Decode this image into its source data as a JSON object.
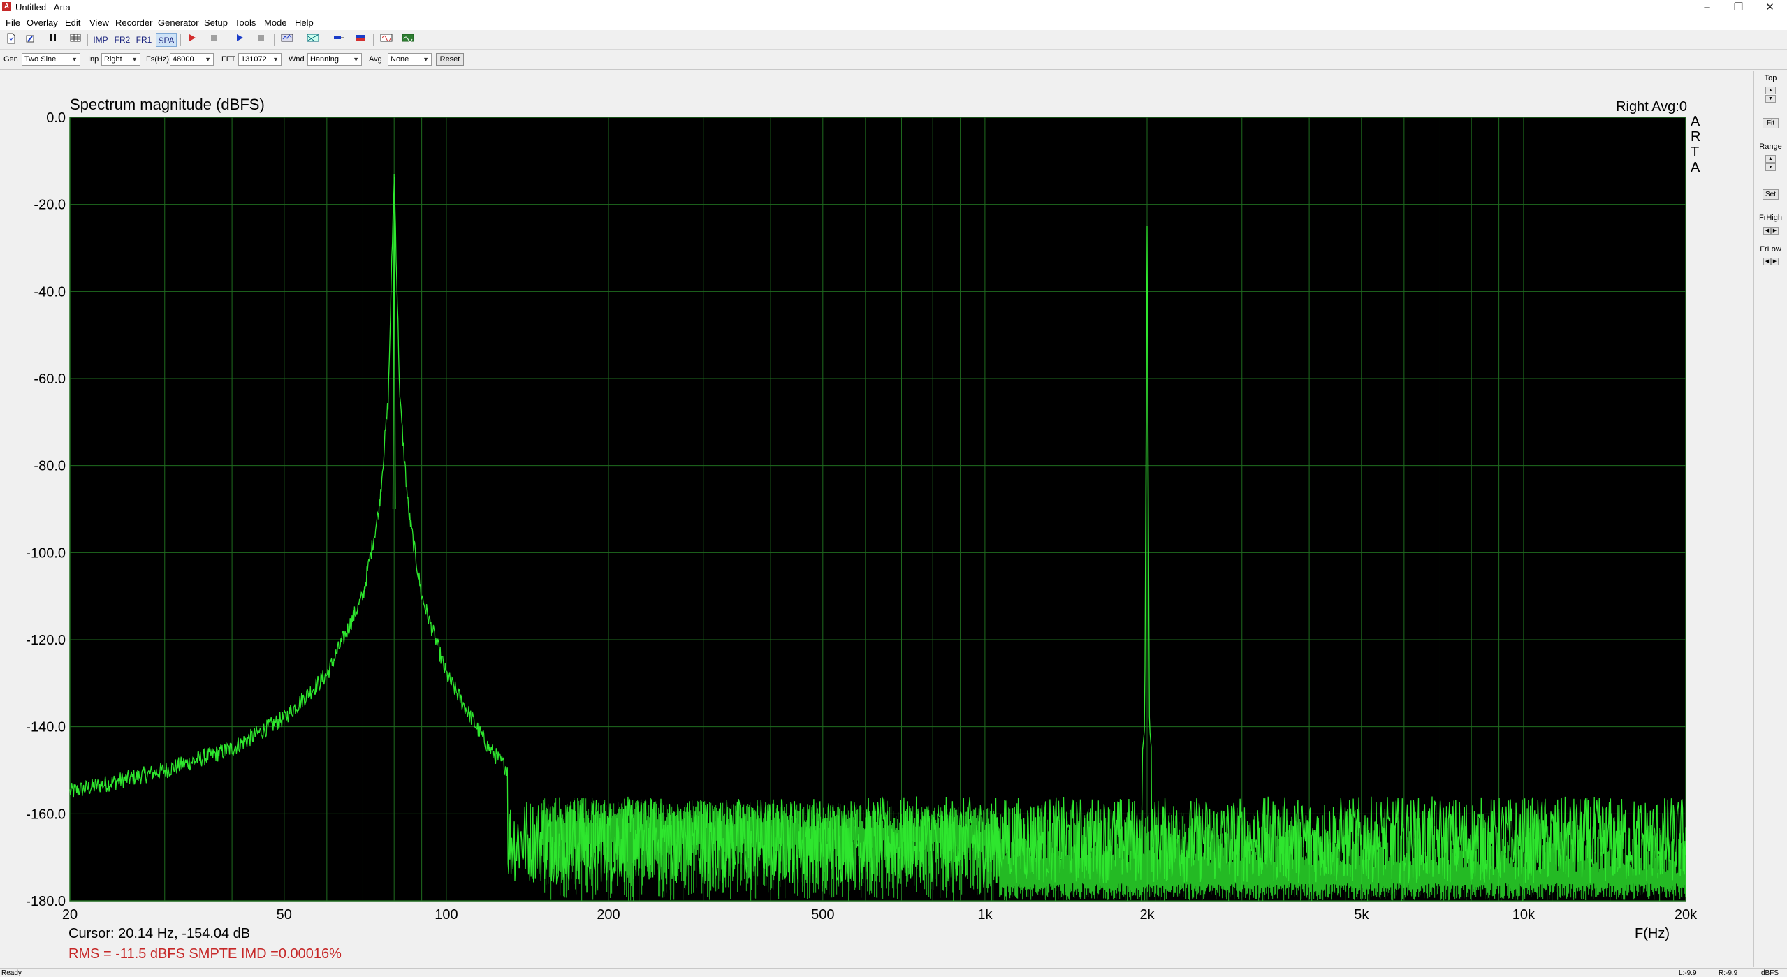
{
  "window": {
    "title": "Untitled - Arta",
    "app_icon": "A",
    "minimize": "–",
    "restore": "❐",
    "close": "✕"
  },
  "menu": [
    "File",
    "Overlay",
    "Edit",
    "View",
    "Recorder",
    "Generator",
    "Setup",
    "Tools",
    "Mode",
    "Help"
  ],
  "toolbar": {
    "new_icon": "new-file-icon",
    "open_icon": "open-icon",
    "pause_icon": "pause-icon",
    "grid_icon": "grid-icon",
    "imp": "IMP",
    "fr2": "FR2",
    "fr1": "FR1",
    "spa": "SPA",
    "record_icon": "record-icon",
    "stop_icon": "stop-icon",
    "play_icon": "play-icon",
    "stop2_icon": "stop-icon",
    "scope_icon": "scope-icon",
    "calibrate_icon": "calibrate-icon",
    "probe_icon": "probe-icon",
    "meter_icon": "meter-icon",
    "signal_icon": "signal-icon",
    "overlay_icon": "overlay-icon",
    "accent_red": "#d32f2f",
    "accent_blue": "#1a3cc8"
  },
  "controls": {
    "gen_label": "Gen",
    "gen_value": "Two Sine",
    "inp_label": "Inp",
    "inp_value": "Right",
    "fs_label": "Fs(Hz)",
    "fs_value": "48000",
    "fft_label": "FFT",
    "fft_value": "131072",
    "wnd_label": "Wnd",
    "wnd_value": "Hanning",
    "avg_label": "Avg",
    "avg_value": "None",
    "reset": "Reset"
  },
  "plot": {
    "title": "Spectrum magnitude (dBFS)",
    "channel_info": "Right  Avg:0",
    "watermark": [
      "A",
      "R",
      "T",
      "A"
    ],
    "cursor": "Cursor: 20.14 Hz, -154.04 dB",
    "measurement": "RMS =  -11.5 dBFS  SMPTE IMD =0.00016%",
    "background": "#000000",
    "grid_color": "#1f6b1f",
    "trace_color": "#2ee62e",
    "measurement_color": "#c62828"
  },
  "right_panel": {
    "top": "Top",
    "fit": "Fit",
    "range": "Range",
    "set": "Set",
    "frhigh": "FrHigh",
    "frlow": "FrLow",
    "up": "▲",
    "down": "▼",
    "left": "◀",
    "right": "▶"
  },
  "status": {
    "ready": "Ready",
    "left_level": "L:-9.9",
    "right_level": "R:-9.9",
    "unit": "dBFS"
  },
  "chart_data": {
    "type": "line",
    "title": "Spectrum magnitude (dBFS)",
    "xlabel": "F(Hz)",
    "ylabel": "",
    "x_scale": "log",
    "xlim": [
      20,
      20000
    ],
    "ylim": [
      -180,
      0
    ],
    "x_ticks": [
      20,
      50,
      100,
      200,
      500,
      1000,
      2000,
      5000,
      10000,
      20000
    ],
    "x_tick_labels": [
      "20",
      "50",
      "100",
      "200",
      "500",
      "1k",
      "2k",
      "5k",
      "10k",
      "20k"
    ],
    "y_ticks": [
      0,
      -20,
      -40,
      -60,
      -80,
      -100,
      -120,
      -140,
      -160,
      -180
    ],
    "y_tick_labels": [
      "0.0",
      "-20.0",
      "-40.0",
      "-60.0",
      "-80.0",
      "-100.0",
      "-120.0",
      "-140.0",
      "-160.0",
      "-180.0"
    ],
    "grid": true,
    "series": [
      {
        "values_x": [
          20,
          30,
          40,
          50,
          60,
          70,
          75,
          78,
          80,
          82,
          85,
          90,
          100,
          120,
          150,
          200,
          250,
          300,
          500,
          700,
          1000,
          1500,
          1900,
          1980,
          2000,
          2020,
          2100,
          3000,
          5000,
          10000,
          20000
        ],
        "values_y": [
          -155,
          -150,
          -145,
          -138,
          -128,
          -110,
          -90,
          -65,
          -13,
          -65,
          -90,
          -110,
          -128,
          -145,
          -158,
          -168,
          -168,
          -167,
          -166,
          -165,
          -164,
          -163,
          -163,
          -140,
          -25,
          -140,
          -163,
          -162,
          -162,
          -161,
          -161
        ]
      }
    ],
    "peaks": [
      {
        "x": 80,
        "y": -13
      },
      {
        "x": 2000,
        "y": -25
      }
    ],
    "noise_floor": {
      "from": 150,
      "to": 20000,
      "low": -180,
      "high": -158
    }
  }
}
